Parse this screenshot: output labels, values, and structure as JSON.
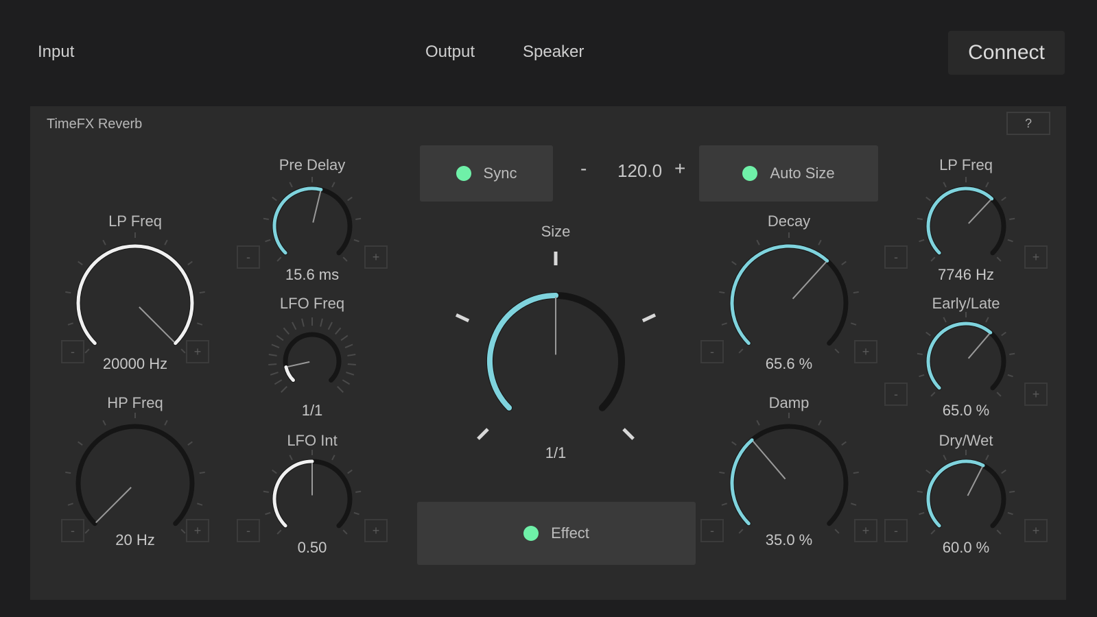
{
  "topbar": {
    "input_tab": "Input",
    "output_tab": "Output",
    "speaker_tab": "Speaker",
    "connect_label": "Connect"
  },
  "plugin": {
    "title": "TimeFX Reverb",
    "help_label": "?"
  },
  "colors": {
    "accent": "#7fd3dd",
    "white_arc": "#f0f0f0",
    "track": "#151515",
    "led": "#6ff0a8",
    "panel": "#2b2b2b"
  },
  "controls": {
    "sync": {
      "label": "Sync",
      "on": true
    },
    "auto_size": {
      "label": "Auto Size",
      "on": true
    },
    "effect": {
      "label": "Effect",
      "on": true
    },
    "bpm": {
      "minus": "-",
      "value": "120.0",
      "plus": "+"
    },
    "stepper_minus": "-",
    "stepper_plus": "+"
  },
  "knobs": {
    "lp_freq_left": {
      "label": "LP Freq",
      "value": "20000 Hz",
      "level": 1.0
    },
    "hp_freq": {
      "label": "HP Freq",
      "value": "20 Hz",
      "level": 0.0
    },
    "pre_delay": {
      "label": "Pre Delay",
      "value": "15.6 ms",
      "level": 0.55
    },
    "lfo_freq": {
      "label": "LFO Freq",
      "value": "1/1",
      "level": 0.12
    },
    "lfo_int": {
      "label": "LFO Int",
      "value": "0.50",
      "level": 0.5
    },
    "size": {
      "label": "Size",
      "value": "1/1",
      "level": 0.5
    },
    "decay": {
      "label": "Decay",
      "value": "65.6 %",
      "level": 0.656
    },
    "damp": {
      "label": "Damp",
      "value": "35.0 %",
      "level": 0.35
    },
    "lp_freq_right": {
      "label": "LP Freq",
      "value": "7746 Hz",
      "level": 0.66
    },
    "early_late": {
      "label": "Early/Late",
      "value": "65.0 %",
      "level": 0.65
    },
    "dry_wet": {
      "label": "Dry/Wet",
      "value": "60.0 %",
      "level": 0.6
    }
  }
}
